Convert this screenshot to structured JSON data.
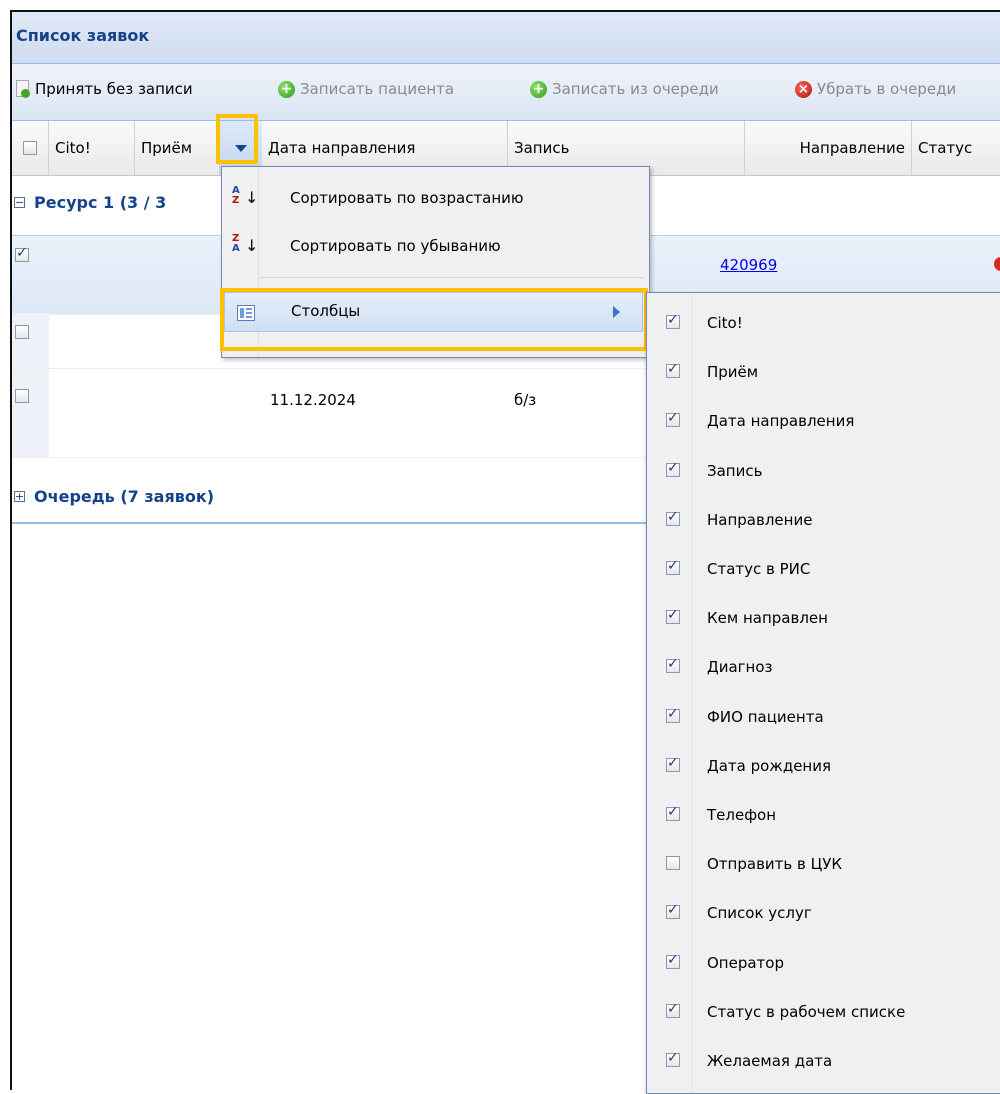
{
  "window": {
    "title": "Список заявок"
  },
  "toolbar": {
    "accept_without_record": "Принять без записи",
    "record_patient": "Записать пациента",
    "record_from_queue": "Записать из очереди",
    "move_to_queue": "Убрать в очереди"
  },
  "grid": {
    "columns": {
      "cito": "Cito!",
      "reception": "Приём",
      "referral_date": "Дата направления",
      "record": "Запись",
      "direction": "Направление",
      "status": "Статус"
    },
    "groups": {
      "resource": "Ресурс 1 (3 / 3",
      "queue": "Очередь (7 заявок)"
    },
    "rows": [
      {
        "checked": true,
        "direction": "420969"
      },
      {
        "checked": false
      },
      {
        "checked": false,
        "referral_date": "11.12.2024",
        "record": "б/з"
      }
    ]
  },
  "column_menu": {
    "sort_asc": "Сортировать по возрастанию",
    "sort_desc": "Сортировать по убыванию",
    "columns": "Столбцы",
    "icons": [
      "sort-ascending-icon",
      "sort-descending-icon",
      "columns-icon"
    ]
  },
  "columns_submenu": {
    "items": [
      {
        "label": "Cito!",
        "checked": true
      },
      {
        "label": "Приём",
        "checked": true
      },
      {
        "label": "Дата направления",
        "checked": true
      },
      {
        "label": "Запись",
        "checked": true
      },
      {
        "label": "Направление",
        "checked": true
      },
      {
        "label": "Статус в РИС",
        "checked": true
      },
      {
        "label": "Кем направлен",
        "checked": true
      },
      {
        "label": "Диагноз",
        "checked": true
      },
      {
        "label": "ФИО пациента",
        "checked": true
      },
      {
        "label": "Дата рождения",
        "checked": true
      },
      {
        "label": "Телефон",
        "checked": true
      },
      {
        "label": "Отправить в ЦУК",
        "checked": false
      },
      {
        "label": "Список услуг",
        "checked": true
      },
      {
        "label": "Оператор",
        "checked": true
      },
      {
        "label": "Статус в рабочем списке",
        "checked": true
      },
      {
        "label": "Желаемая дата",
        "checked": true
      }
    ]
  },
  "colors": {
    "highlight": "#ffc000",
    "header_text": "#15428b",
    "link": "#0000ee"
  }
}
